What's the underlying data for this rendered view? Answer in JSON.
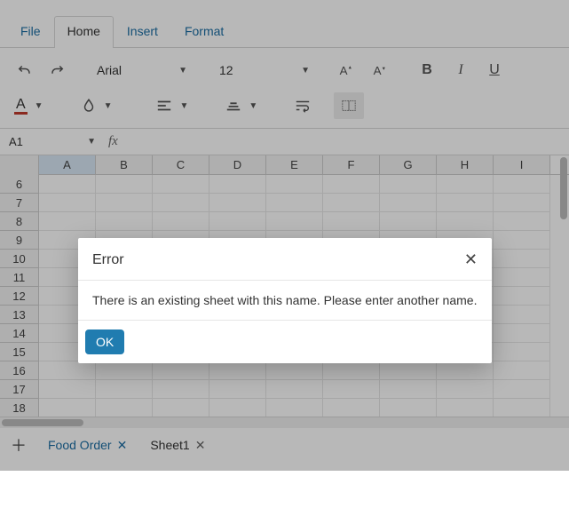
{
  "menu": {
    "tabs": [
      {
        "label": "File",
        "active": false
      },
      {
        "label": "Home",
        "active": true
      },
      {
        "label": "Insert",
        "active": false
      },
      {
        "label": "Format",
        "active": false
      }
    ]
  },
  "ribbon": {
    "font_name": "Arial",
    "font_size": "12",
    "font_color_underline_hex": "#c0392b",
    "fontA_label": "A"
  },
  "cellref": {
    "value": "A1",
    "fx_label": "fx"
  },
  "grid": {
    "columns": [
      "A",
      "B",
      "C",
      "D",
      "E",
      "F",
      "G",
      "H",
      "I"
    ],
    "selected_col": "A",
    "row_start": 6,
    "row_end": 18
  },
  "sheets": {
    "add_icon": "＋",
    "tabs": [
      {
        "name": "Food Order",
        "active": true,
        "editing": false
      },
      {
        "name": "Sheet1",
        "active": false,
        "editing": false
      }
    ]
  },
  "modal": {
    "title": "Error",
    "message": "There is an existing sheet with this name. Please enter another name.",
    "ok_label": "OK"
  },
  "icons": {
    "close_x": "✕"
  }
}
